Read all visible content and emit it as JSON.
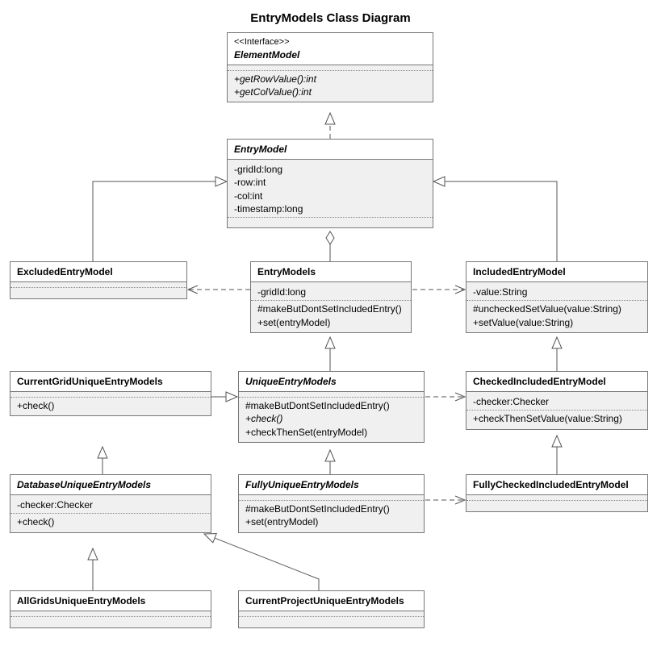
{
  "title": "EntryModels Class Diagram",
  "elementModel": {
    "stereotype": "<<Interface>>",
    "name": "ElementModel",
    "op1": "+getRowValue():int",
    "op2": "+getColValue():int"
  },
  "entryModel": {
    "name": "EntryModel",
    "a1": "-gridId:long",
    "a2": "-row:int",
    "a3": "-col:int",
    "a4": "-timestamp:long"
  },
  "excludedEntryModel": {
    "name": "ExcludedEntryModel"
  },
  "entryModels": {
    "name": "EntryModels",
    "a1": "-gridId:long",
    "o1": "#makeButDontSetIncludedEntry()",
    "o2": "+set(entryModel)"
  },
  "includedEntryModel": {
    "name": "IncludedEntryModel",
    "a1": "-value:String",
    "o1": "#uncheckedSetValue(value:String)",
    "o2": "+setValue(value:String)"
  },
  "currentGridUniqueEntryModels": {
    "name": "CurrentGridUniqueEntryModels",
    "o1": "+check()"
  },
  "uniqueEntryModels": {
    "name": "UniqueEntryModels",
    "o1": "#makeButDontSetIncludedEntry()",
    "o2": "+check()",
    "o3": "+checkThenSet(entryModel)"
  },
  "checkedIncludedEntryModel": {
    "name": "CheckedIncludedEntryModel",
    "a1": "-checker:Checker",
    "o1": "+checkThenSetValue(value:String)"
  },
  "databaseUniqueEntryModels": {
    "name": "DatabaseUniqueEntryModels",
    "a1": "-checker:Checker",
    "o1": "+check()"
  },
  "fullyUniqueEntryModels": {
    "name": "FullyUniqueEntryModels",
    "o1": "#makeButDontSetIncludedEntry()",
    "o2": "+set(entryModel)"
  },
  "fullyCheckedIncludedEntryModel": {
    "name": "FullyCheckedIncludedEntryModel"
  },
  "allGridsUniqueEntryModels": {
    "name": "AllGridsUniqueEntryModels"
  },
  "currentProjectUniqueEntryModels": {
    "name": "CurrentProjectUniqueEntryModels"
  }
}
